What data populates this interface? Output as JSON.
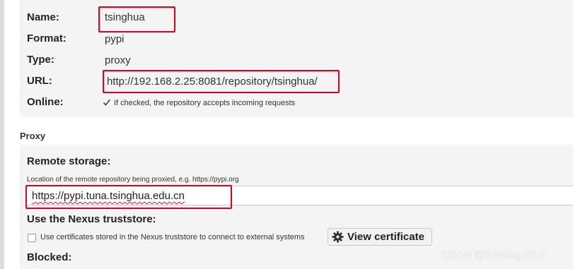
{
  "fields": {
    "name": {
      "label": "Name:",
      "value": "tsinghua"
    },
    "format": {
      "label": "Format:",
      "value": "pypi"
    },
    "type": {
      "label": "Type:",
      "value": "proxy"
    },
    "url": {
      "label": "URL:",
      "value": "http://192.168.2.25:8081/repository/tsinghua/"
    },
    "online": {
      "label": "Online:",
      "checked": true,
      "help": "If checked, the repository accepts incoming requests"
    }
  },
  "proxy": {
    "heading": "Proxy",
    "remote_storage": {
      "label": "Remote storage:",
      "help": "Location of the remote repository being proxied, e.g. https://pypi.org",
      "value": "https://pypi.tuna.tsinghua.edu.cn"
    },
    "truststore": {
      "label": "Use the Nexus truststore:",
      "checked": false,
      "help": "Use certificates stored in the Nexus truststore to connect to external systems",
      "button": "View certificate",
      "button_icon": "gear-icon"
    },
    "blocked": {
      "label": "Blocked:"
    }
  },
  "watermark": "CSDN @thinklog2018",
  "colors": {
    "highlight": "#e0001a",
    "panel": "#f4f4f4"
  }
}
